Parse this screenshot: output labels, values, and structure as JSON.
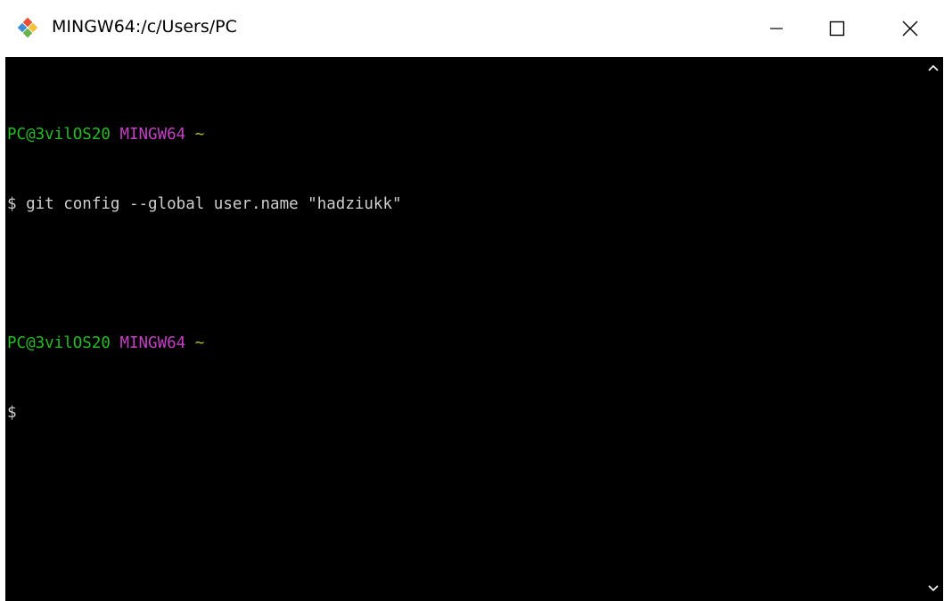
{
  "window": {
    "title": "MINGW64:/c/Users/PC",
    "icon": "git-bash-icon",
    "controls": {
      "minimize": "minimize-icon",
      "maximize": "maximize-icon",
      "close": "close-icon"
    }
  },
  "terminal": {
    "block1": {
      "user_host": "PC@3vilOS20",
      "system": "MINGW64",
      "path": "~",
      "prompt": "$",
      "command": "git config --global user.name \"hadziukk\""
    },
    "block2": {
      "user_host": "PC@3vilOS20",
      "system": "MINGW64",
      "path": "~",
      "prompt": "$"
    }
  },
  "colors": {
    "user_host": "#25bc24",
    "system": "#c640c6",
    "path": "#bcbc24",
    "background": "#000000"
  }
}
